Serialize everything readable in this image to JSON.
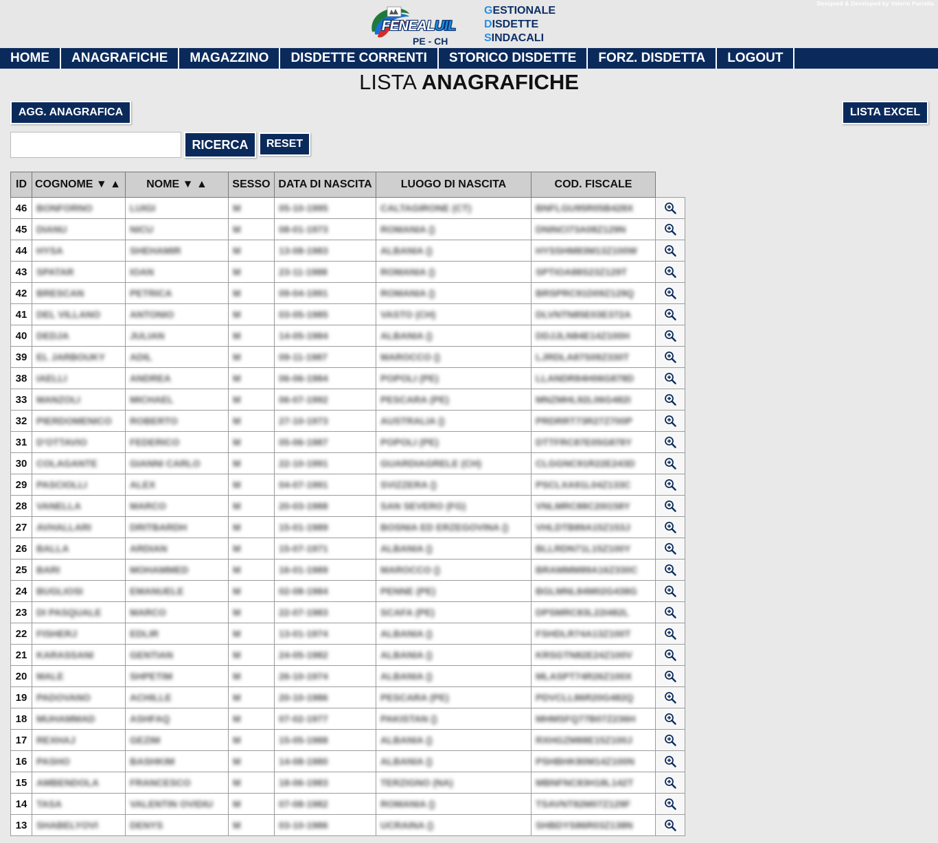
{
  "header": {
    "credit": "Designed & Developed by Valerio Parrella",
    "logo_main": "FENEAL",
    "logo_accent": "UIL",
    "logo_sub": "PE - CH",
    "app_name_lines": [
      {
        "cap": "G",
        "rest": "ESTIONALE"
      },
      {
        "cap": "D",
        "rest": "ISDETTE"
      },
      {
        "cap": "S",
        "rest": "INDACALI"
      }
    ]
  },
  "nav": [
    "HOME",
    "ANAGRAFICHE",
    "MAGAZZINO",
    "DISDETTE CORRENTI",
    "STORICO DISDETTE",
    "FORZ. DISDETTA",
    "LOGOUT"
  ],
  "page_title": {
    "light": "LISTA ",
    "bold": "ANAGRAFICHE"
  },
  "buttons": {
    "add": "AGG. ANAGRAFICA",
    "excel": "LISTA EXCEL",
    "search": "RICERCA",
    "reset": "RESET"
  },
  "search": {
    "value": "",
    "placeholder": ""
  },
  "table": {
    "columns": [
      "ID",
      "COGNOME ▼ ▲",
      "NOME ▼ ▲",
      "SESSO",
      "DATA DI NASCITA",
      "LUOGO DI NASCITA",
      "COD. FISCALE"
    ],
    "action_icon": "zoom-in-icon",
    "rows": [
      {
        "id": "46",
        "cognome": "BONFORNO",
        "nome": "LUIGI",
        "sesso": "M",
        "data": "05-10-1995",
        "luogo": "CALTAGIRONE (CT)",
        "cf": "BNFLGU95R05B428X"
      },
      {
        "id": "45",
        "cognome": "DIANU",
        "nome": "NICU",
        "sesso": "M",
        "data": "08-01-1973",
        "luogo": "ROMANIA ()",
        "cf": "DNINCI73A08Z129N"
      },
      {
        "id": "44",
        "cognome": "HYSA",
        "nome": "SHEHAMIR",
        "sesso": "M",
        "data": "13-08-1983",
        "luogo": "ALBANIA ()",
        "cf": "HYSSHM83M13Z100W"
      },
      {
        "id": "43",
        "cognome": "SPATAR",
        "nome": "IOAN",
        "sesso": "M",
        "data": "23-11-1988",
        "luogo": "ROMANIA ()",
        "cf": "SPTIOA88S23Z129T"
      },
      {
        "id": "42",
        "cognome": "BRESCAN",
        "nome": "PETRICA",
        "sesso": "M",
        "data": "09-04-1991",
        "luogo": "ROMANIA ()",
        "cf": "BRSPRC91D09Z129Q"
      },
      {
        "id": "41",
        "cognome": "DEL VILLANO",
        "nome": "ANTONIO",
        "sesso": "M",
        "data": "03-05-1985",
        "luogo": "VASTO (CH)",
        "cf": "DLVNTN85E03E372A"
      },
      {
        "id": "40",
        "cognome": "DEDJA",
        "nome": "JULIAN",
        "sesso": "M",
        "data": "14-05-1984",
        "luogo": "ALBANIA ()",
        "cf": "DDJJLN84E14Z100H"
      },
      {
        "id": "39",
        "cognome": "EL JARBOUKY",
        "nome": "ADIL",
        "sesso": "M",
        "data": "09-11-1987",
        "luogo": "MAROCCO ()",
        "cf": "LJRDLA87S09Z330T"
      },
      {
        "id": "38",
        "cognome": "IAELLI",
        "nome": "ANDREA",
        "sesso": "M",
        "data": "06-06-1984",
        "luogo": "POPOLI (PE)",
        "cf": "LLANDR84H06G878D"
      },
      {
        "id": "33",
        "cognome": "MANZOLI",
        "nome": "MICHAEL",
        "sesso": "M",
        "data": "06-07-1992",
        "luogo": "PESCARA (PE)",
        "cf": "MNZMHL92L06G482I"
      },
      {
        "id": "32",
        "cognome": "PIERDOMENICO",
        "nome": "ROBERTO",
        "sesso": "M",
        "data": "27-10-1973",
        "luogo": "AUSTRALIA ()",
        "cf": "PRDRRT73R27Z700P"
      },
      {
        "id": "31",
        "cognome": "D'OTTAVIO",
        "nome": "FEDERICO",
        "sesso": "M",
        "data": "05-06-1987",
        "luogo": "POPOLI (PE)",
        "cf": "DTTFRC87E05G878Y"
      },
      {
        "id": "30",
        "cognome": "COLAGANTE",
        "nome": "GIANNI CARLO",
        "sesso": "M",
        "data": "22-10-1991",
        "luogo": "GUARDIAGRELE (CH)",
        "cf": "CLGGNC91R22E243D"
      },
      {
        "id": "29",
        "cognome": "PASCIOLLI",
        "nome": "ALEX",
        "sesso": "M",
        "data": "04-07-1991",
        "luogo": "SVIZZERA ()",
        "cf": "PSCLXA91L04Z133C"
      },
      {
        "id": "28",
        "cognome": "VANELLA",
        "nome": "MARCO",
        "sesso": "M",
        "data": "20-03-1988",
        "luogo": "SAN SEVERO (FG)",
        "cf": "VNLMRC88C20I158Y"
      },
      {
        "id": "27",
        "cognome": "AVHALLARI",
        "nome": "DRITBARDH",
        "sesso": "M",
        "data": "15-01-1989",
        "luogo": "BOSNIA ED ERZEGOVINA ()",
        "cf": "VHLDTB89A15Z153J"
      },
      {
        "id": "26",
        "cognome": "BALLA",
        "nome": "ARDIAN",
        "sesso": "M",
        "data": "15-07-1971",
        "luogo": "ALBANIA ()",
        "cf": "BLLRDN71L15Z100Y"
      },
      {
        "id": "25",
        "cognome": "BARI",
        "nome": "MOHAMMED",
        "sesso": "M",
        "data": "16-01-1989",
        "luogo": "MAROCCO ()",
        "cf": "BRAMMM89A16Z330C"
      },
      {
        "id": "24",
        "cognome": "BUGLIOSI",
        "nome": "EMANUELE",
        "sesso": "M",
        "data": "02-08-1984",
        "luogo": "PENNE (PE)",
        "cf": "BGLMNL84M02G438G"
      },
      {
        "id": "23",
        "cognome": "DI PASQUALE",
        "nome": "MARCO",
        "sesso": "M",
        "data": "22-07-1983",
        "luogo": "SCAFA (PE)",
        "cf": "DPSMRC83L22I482L"
      },
      {
        "id": "22",
        "cognome": "FISHERJ",
        "nome": "EDLIR",
        "sesso": "M",
        "data": "13-01-1974",
        "luogo": "ALBANIA ()",
        "cf": "FSHDLR74A13Z100T"
      },
      {
        "id": "21",
        "cognome": "KARASSANI",
        "nome": "GENTIAN",
        "sesso": "M",
        "data": "24-05-1982",
        "luogo": "ALBANIA ()",
        "cf": "KRSGTN82E24Z100V"
      },
      {
        "id": "20",
        "cognome": "MALE",
        "nome": "SHPETIM",
        "sesso": "M",
        "data": "26-10-1974",
        "luogo": "ALBANIA ()",
        "cf": "MLASPT74R26Z100X"
      },
      {
        "id": "19",
        "cognome": "PADOVANO",
        "nome": "ACHILLE",
        "sesso": "M",
        "data": "20-10-1986",
        "luogo": "PESCARA (PE)",
        "cf": "PDVCLL86R20G482Q"
      },
      {
        "id": "18",
        "cognome": "MUHAMMAD",
        "nome": "ASHFAQ",
        "sesso": "M",
        "data": "07-02-1977",
        "luogo": "PAKISTAN ()",
        "cf": "MHMSFQ77B07Z236H"
      },
      {
        "id": "17",
        "cognome": "REXHAJ",
        "nome": "GEZIM",
        "sesso": "M",
        "data": "15-05-1988",
        "luogo": "ALBANIA ()",
        "cf": "RXHGZM88E15Z100J"
      },
      {
        "id": "16",
        "cognome": "PASHO",
        "nome": "BASHKIM",
        "sesso": "M",
        "data": "14-08-1980",
        "luogo": "ALBANIA ()",
        "cf": "PSHBHK80M14Z100N"
      },
      {
        "id": "15",
        "cognome": "AMBENDOLA",
        "nome": "FRANCESCO",
        "sesso": "M",
        "data": "18-06-1983",
        "luogo": "TERZIGNO (NA)",
        "cf": "MBNFNC83H18L142T"
      },
      {
        "id": "14",
        "cognome": "TASA",
        "nome": "VALENTIN OVIDIU",
        "sesso": "M",
        "data": "07-08-1982",
        "luogo": "ROMANIA ()",
        "cf": "TSAVNT82M07Z129F"
      },
      {
        "id": "13",
        "cognome": "SHABELYOVI",
        "nome": "DENYS",
        "sesso": "M",
        "data": "03-10-1986",
        "luogo": "UCRAINA ()",
        "cf": "SHBDYS86R03Z138N"
      }
    ]
  }
}
